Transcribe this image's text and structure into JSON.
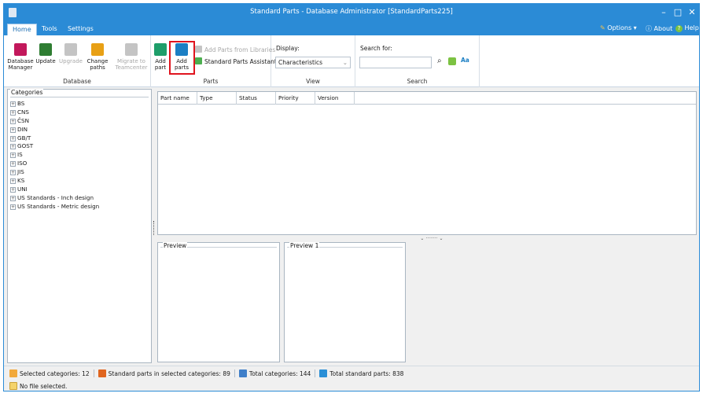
{
  "window": {
    "title": "Standard Parts - Database Administrator [StandardParts225]",
    "controls": {
      "minimize": "–",
      "maximize": "□",
      "close": "✕"
    }
  },
  "menubar": {
    "tabs": [
      "Home",
      "Tools",
      "Settings"
    ],
    "active_tab": "Home",
    "options": "Options",
    "options_arrow": "▾",
    "about": "About",
    "help": "Help"
  },
  "ribbon": {
    "database": {
      "label": "Database",
      "buttons": [
        {
          "label1": "Database",
          "label2": "Manager",
          "icon": "database-manager-icon",
          "color": "#c2185b",
          "enabled": true
        },
        {
          "label1": "Update",
          "label2": "",
          "icon": "update-icon",
          "color": "#2e7d32",
          "enabled": true
        },
        {
          "label1": "Upgrade",
          "label2": "",
          "icon": "upgrade-icon",
          "color": "#b0b0b0",
          "enabled": false
        },
        {
          "label1": "Change",
          "label2": "paths",
          "icon": "change-paths-icon",
          "color": "#e8a015",
          "enabled": true
        },
        {
          "label1": "Migrate to",
          "label2": "Teamcenter",
          "icon": "migrate-icon",
          "color": "#b0b0b0",
          "enabled": false
        }
      ]
    },
    "parts": {
      "label": "Parts",
      "add_part_1": "Add",
      "add_part_2": "part",
      "add_parts_1": "Add",
      "add_parts_2": "parts",
      "add_from_libraries": "Add Parts from Libraries",
      "assistant": "Standard Parts Assistant"
    },
    "view": {
      "label": "View",
      "display_label": "Display:",
      "display_value": "Characteristics",
      "dropdown_arrow": "⌄"
    },
    "search": {
      "label": "Search",
      "search_for_label": "Search for:",
      "search_value": "",
      "text_icon": "Aa"
    }
  },
  "categories": {
    "title": "Categories",
    "expand_symbol": "+",
    "items": [
      "BS",
      "CNS",
      "ČSN",
      "DIN",
      "GB/T",
      "GOST",
      "IS",
      "ISO",
      "JIS",
      "KS",
      "UNI",
      "US Standards - Inch design",
      "US Standards - Metric design"
    ]
  },
  "table": {
    "columns": [
      "Part name",
      "Type",
      "Status",
      "Priority",
      "Version"
    ]
  },
  "previews": [
    "Preview",
    "Preview 1"
  ],
  "splitter": {
    "grip": "⌄ ········ ⌄"
  },
  "status": {
    "selected_categories": "Selected categories:  12",
    "parts_in_selected": "Standard parts in selected categories:  89",
    "total_categories": "Total categories:  144",
    "total_parts": "Total standard parts:  838",
    "file": "No file selected."
  },
  "colors": {
    "accent": "#2b8bd6",
    "highlight": "#e0141e"
  }
}
